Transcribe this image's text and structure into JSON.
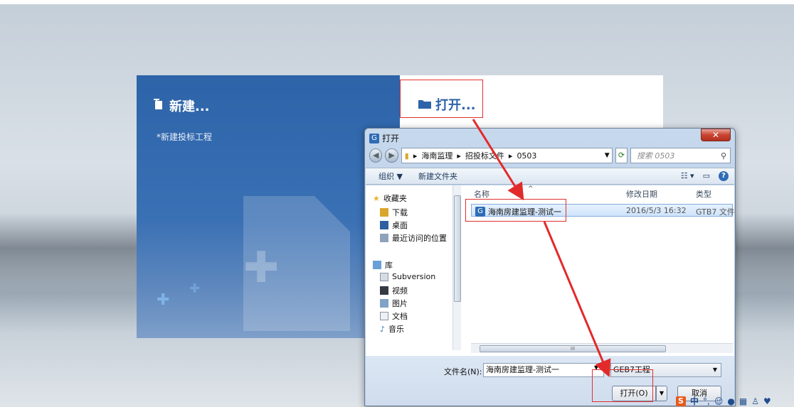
{
  "left_panel": {
    "title": "新建...",
    "new_project_link": "*新建投标工程"
  },
  "right_panel": {
    "title": "打开..."
  },
  "dialog": {
    "title": "打开",
    "breadcrumb": [
      "海南监理",
      "招投标文件",
      "0503"
    ],
    "search_placeholder": "搜索 0503",
    "toolbar": {
      "organize": "组织 ▼",
      "new_folder": "新建文件夹"
    },
    "sidebar": {
      "favorites_label": "收藏夹",
      "favorites": [
        "下载",
        "桌面",
        "最近访问的位置"
      ],
      "libraries_label": "库",
      "libraries": [
        "Subversion",
        "视频",
        "图片",
        "文档",
        "音乐"
      ]
    },
    "columns": {
      "name": "名称",
      "modified": "修改日期",
      "type": "类型"
    },
    "files": [
      {
        "name": "海南房建监理-测试一",
        "modified": "2016/5/3 16:32",
        "type": "GTB7 文件"
      }
    ],
    "filename_label": "文件名(N):",
    "filename_value": "海南房建监理-测试一",
    "filetype_value": "GEB7工程",
    "open_button": "打开(O)",
    "cancel_button": "取消"
  },
  "tray": {
    "ime": "中"
  },
  "colors": {
    "accent": "#2d63a8",
    "highlight_box": "#e03030"
  }
}
